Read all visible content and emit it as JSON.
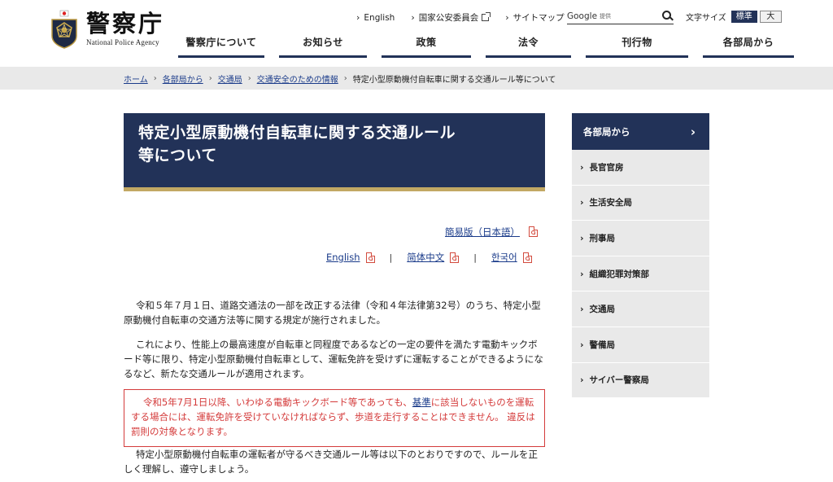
{
  "header": {
    "logo_jp": "警察庁",
    "logo_en": "National Police Agency",
    "util_links": [
      {
        "label": "English",
        "external": false
      },
      {
        "label": "国家公安委員会",
        "external": true
      },
      {
        "label": "サイトマップ",
        "external": false
      }
    ],
    "search": {
      "google_label": "Google",
      "provided_label": "提供",
      "placeholder": ""
    },
    "fontsize": {
      "label": "文字サイズ",
      "standard": "標準",
      "large": "大"
    },
    "nav": [
      "警察庁について",
      "お知らせ",
      "政策",
      "法令",
      "刊行物",
      "各部局から"
    ]
  },
  "breadcrumb": {
    "links": [
      "ホーム",
      "各部局から",
      "交通局",
      "交通安全のための情報"
    ],
    "current": "特定小型原動機付自転車に関する交通ルール等について"
  },
  "main": {
    "title_line1": "特定小型原動機付自転車に関する交通ルール",
    "title_line2": "等について",
    "easy_version": "簡易版（日本語）",
    "languages": [
      "English",
      "简体中文",
      "한국어"
    ],
    "para1": "令和５年７月１日、道路交通法の一部を改正する法律（令和４年法律第32号）のうち、特定小型原動機付自転車の交通方法等に関する規定が施行されました。",
    "para2": "これにより、性能上の最高速度が自転車と同程度であるなどの一定の要件を満たす電動キックボード等に限り、特定小型原動機付自転車として、運転免許を受けずに運転することができるようになるなど、新たな交通ルールが適用されます。",
    "notice_before": "令和5年7月1日以降、いわゆる電動キックボード等であっても、",
    "notice_link": "基準",
    "notice_after": "に該当しないものを運転する場合には、運転免許を受けていなければならず、歩道を走行することはできません。 違反は罰則の対象となります。",
    "para4": "特定小型原動機付自転車の運転者が守るべき交通ルール等は以下のとおりですので、ルールを正しく理解し、遵守しましょう。"
  },
  "sidebar": {
    "heading": "各部局から",
    "items": [
      "長官官房",
      "生活安全局",
      "刑事局",
      "組織犯罪対策部",
      "交通局",
      "警備局",
      "サイバー警察局"
    ]
  },
  "colors": {
    "navy": "#223258",
    "gold": "#c2a864",
    "notice_red": "#d43b3b",
    "link": "#1a3b8a"
  }
}
